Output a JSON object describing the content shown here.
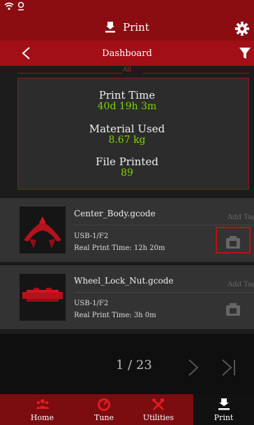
{
  "header": {
    "title": "Print",
    "subtitle": "Dashboard"
  },
  "stats": {
    "legend": "All",
    "print_time_label": "Print Time",
    "print_time_value": "40d 19h 3m",
    "material_label": "Material Used",
    "material_value": "8.67 kg",
    "files_label": "File Printed",
    "files_value": "89"
  },
  "files": [
    {
      "name": "Center_Body.gcode",
      "source": "USB-1/F2",
      "print_time": "Real Print Time: 12h 20m",
      "add_tag": "Add Tag"
    },
    {
      "name": "Wheel_Lock_Nut.gcode",
      "source": "USB-1/F2",
      "print_time": "Real Print Time: 3h 0m",
      "add_tag": "Add Tag"
    }
  ],
  "pagination": {
    "text": "1 / 23"
  },
  "nav": [
    {
      "label": "Home",
      "icon": "home-people-icon"
    },
    {
      "label": "Tune",
      "icon": "tune-gauge-icon"
    },
    {
      "label": "Utilities",
      "icon": "utilities-tools-icon"
    },
    {
      "label": "Print",
      "icon": "print-icon"
    }
  ],
  "colors": {
    "brand_red": "#8b0d12",
    "accent_green": "#7fd400",
    "highlight_red": "#c10e14"
  }
}
